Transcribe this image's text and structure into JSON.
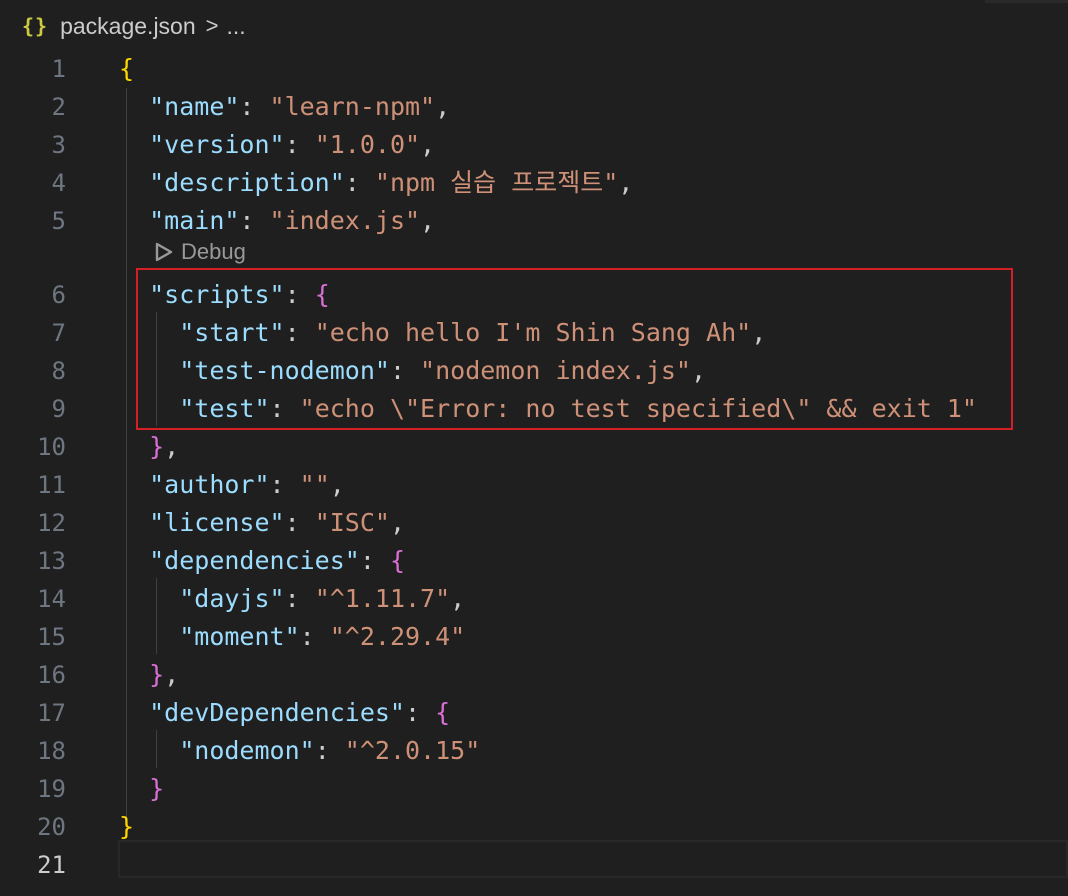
{
  "breadcrumb": {
    "icon": "{}",
    "file": "package.json",
    "separator": ">",
    "more": "..."
  },
  "codelens": {
    "label": "Debug"
  },
  "lines": [
    {
      "n": "1",
      "tokens": [
        {
          "t": "{",
          "c": "b1"
        }
      ]
    },
    {
      "n": "2",
      "tokens": [
        {
          "t": "  ",
          "c": "p"
        },
        {
          "t": "\"name\"",
          "c": "k"
        },
        {
          "t": ": ",
          "c": "p"
        },
        {
          "t": "\"learn-npm\"",
          "c": "s"
        },
        {
          "t": ",",
          "c": "p"
        }
      ]
    },
    {
      "n": "3",
      "tokens": [
        {
          "t": "  ",
          "c": "p"
        },
        {
          "t": "\"version\"",
          "c": "k"
        },
        {
          "t": ": ",
          "c": "p"
        },
        {
          "t": "\"1.0.0\"",
          "c": "s"
        },
        {
          "t": ",",
          "c": "p"
        }
      ]
    },
    {
      "n": "4",
      "tokens": [
        {
          "t": "  ",
          "c": "p"
        },
        {
          "t": "\"description\"",
          "c": "k"
        },
        {
          "t": ": ",
          "c": "p"
        },
        {
          "t": "\"npm 실습 프로젝트\"",
          "c": "s"
        },
        {
          "t": ",",
          "c": "p"
        }
      ]
    },
    {
      "n": "5",
      "tokens": [
        {
          "t": "  ",
          "c": "p"
        },
        {
          "t": "\"main\"",
          "c": "k"
        },
        {
          "t": ": ",
          "c": "p"
        },
        {
          "t": "\"index.js\"",
          "c": "s"
        },
        {
          "t": ",",
          "c": "p"
        }
      ]
    },
    {
      "n": "6",
      "tokens": [
        {
          "t": "  ",
          "c": "p"
        },
        {
          "t": "\"scripts\"",
          "c": "k"
        },
        {
          "t": ": ",
          "c": "p"
        },
        {
          "t": "{",
          "c": "b2"
        }
      ]
    },
    {
      "n": "7",
      "tokens": [
        {
          "t": "    ",
          "c": "p"
        },
        {
          "t": "\"start\"",
          "c": "k"
        },
        {
          "t": ": ",
          "c": "p"
        },
        {
          "t": "\"echo hello I'm Shin Sang Ah\"",
          "c": "s"
        },
        {
          "t": ",",
          "c": "p"
        }
      ]
    },
    {
      "n": "8",
      "tokens": [
        {
          "t": "    ",
          "c": "p"
        },
        {
          "t": "\"test-nodemon\"",
          "c": "k"
        },
        {
          "t": ": ",
          "c": "p"
        },
        {
          "t": "\"nodemon index.js\"",
          "c": "s"
        },
        {
          "t": ",",
          "c": "p"
        }
      ]
    },
    {
      "n": "9",
      "tokens": [
        {
          "t": "    ",
          "c": "p"
        },
        {
          "t": "\"test\"",
          "c": "k"
        },
        {
          "t": ": ",
          "c": "p"
        },
        {
          "t": "\"echo \\\"Error: no test specified\\\" && exit 1\"",
          "c": "s"
        }
      ]
    },
    {
      "n": "10",
      "tokens": [
        {
          "t": "  ",
          "c": "p"
        },
        {
          "t": "}",
          "c": "b2"
        },
        {
          "t": ",",
          "c": "p"
        }
      ]
    },
    {
      "n": "11",
      "tokens": [
        {
          "t": "  ",
          "c": "p"
        },
        {
          "t": "\"author\"",
          "c": "k"
        },
        {
          "t": ": ",
          "c": "p"
        },
        {
          "t": "\"\"",
          "c": "s"
        },
        {
          "t": ",",
          "c": "p"
        }
      ]
    },
    {
      "n": "12",
      "tokens": [
        {
          "t": "  ",
          "c": "p"
        },
        {
          "t": "\"license\"",
          "c": "k"
        },
        {
          "t": ": ",
          "c": "p"
        },
        {
          "t": "\"ISC\"",
          "c": "s"
        },
        {
          "t": ",",
          "c": "p"
        }
      ]
    },
    {
      "n": "13",
      "tokens": [
        {
          "t": "  ",
          "c": "p"
        },
        {
          "t": "\"dependencies\"",
          "c": "k"
        },
        {
          "t": ": ",
          "c": "p"
        },
        {
          "t": "{",
          "c": "b2"
        }
      ]
    },
    {
      "n": "14",
      "tokens": [
        {
          "t": "    ",
          "c": "p"
        },
        {
          "t": "\"dayjs\"",
          "c": "k"
        },
        {
          "t": ": ",
          "c": "p"
        },
        {
          "t": "\"^1.11.7\"",
          "c": "s"
        },
        {
          "t": ",",
          "c": "p"
        }
      ]
    },
    {
      "n": "15",
      "tokens": [
        {
          "t": "    ",
          "c": "p"
        },
        {
          "t": "\"moment\"",
          "c": "k"
        },
        {
          "t": ": ",
          "c": "p"
        },
        {
          "t": "\"^2.29.4\"",
          "c": "s"
        }
      ]
    },
    {
      "n": "16",
      "tokens": [
        {
          "t": "  ",
          "c": "p"
        },
        {
          "t": "}",
          "c": "b2"
        },
        {
          "t": ",",
          "c": "p"
        }
      ]
    },
    {
      "n": "17",
      "tokens": [
        {
          "t": "  ",
          "c": "p"
        },
        {
          "t": "\"devDependencies\"",
          "c": "k"
        },
        {
          "t": ": ",
          "c": "p"
        },
        {
          "t": "{",
          "c": "b2"
        }
      ]
    },
    {
      "n": "18",
      "tokens": [
        {
          "t": "    ",
          "c": "p"
        },
        {
          "t": "\"nodemon\"",
          "c": "k"
        },
        {
          "t": ": ",
          "c": "p"
        },
        {
          "t": "\"^2.0.15\"",
          "c": "s"
        }
      ]
    },
    {
      "n": "19",
      "tokens": [
        {
          "t": "  ",
          "c": "p"
        },
        {
          "t": "}",
          "c": "b2"
        }
      ]
    },
    {
      "n": "20",
      "tokens": [
        {
          "t": "}",
          "c": "b1"
        }
      ]
    },
    {
      "n": "21",
      "tokens": [],
      "active": true
    }
  ],
  "colors": {
    "background": "#1f1f1f",
    "key": "#9cdcfe",
    "string": "#ce9178",
    "punctuation": "#cccccc",
    "bracket_outer": "#ffd700",
    "bracket_inner": "#da70d6",
    "highlight_box": "#d41f26"
  }
}
